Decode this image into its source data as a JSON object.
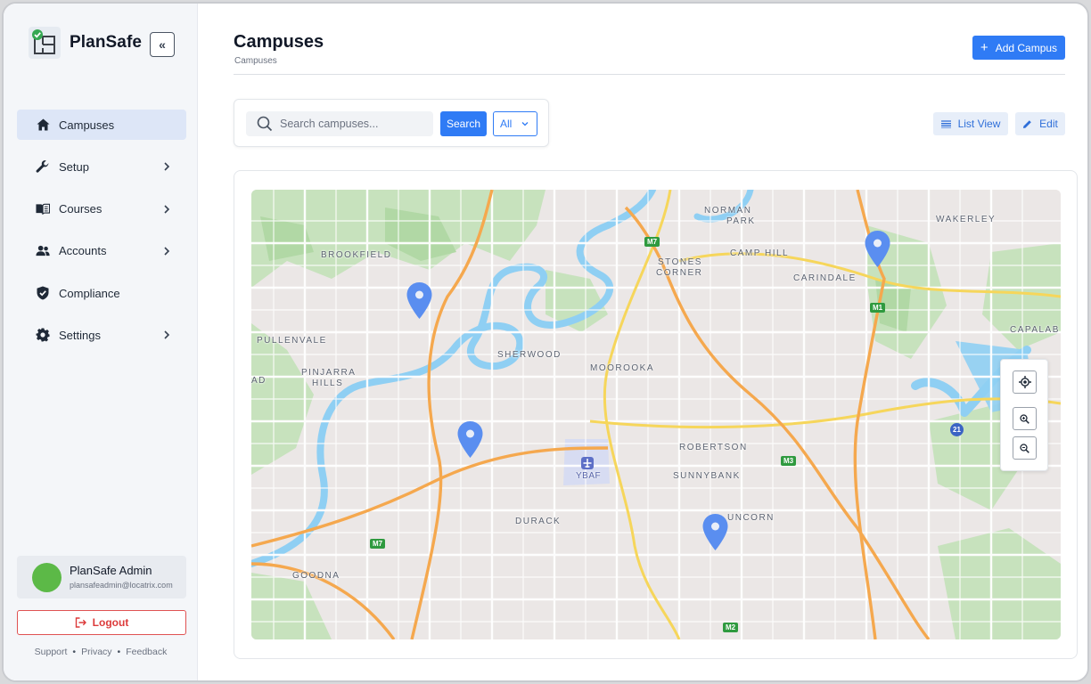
{
  "app": {
    "name": "PlanSafe",
    "collapse_label": "«",
    "logo_icon": "building-floorplan-check-icon"
  },
  "sidebar": {
    "items": [
      {
        "label": "Campuses",
        "icon": "home-icon",
        "active": true,
        "has_submenu": false
      },
      {
        "label": "Setup",
        "icon": "wrench-icon",
        "active": false,
        "has_submenu": true
      },
      {
        "label": "Courses",
        "icon": "book-icon",
        "active": false,
        "has_submenu": true
      },
      {
        "label": "Accounts",
        "icon": "users-icon",
        "active": false,
        "has_submenu": true
      },
      {
        "label": "Compliance",
        "icon": "shield-check-icon",
        "active": false,
        "has_submenu": false
      },
      {
        "label": "Settings",
        "icon": "gear-icon",
        "active": false,
        "has_submenu": true
      }
    ],
    "user": {
      "name": "PlanSafe Admin",
      "email": "plansafeadmin@locatrix.com"
    },
    "logout_label": "Logout",
    "footer_links": [
      "Support",
      "Privacy",
      "Feedback"
    ]
  },
  "header": {
    "title": "Campuses",
    "breadcrumb": "Campuses",
    "add_button": "Add Campus"
  },
  "toolbar": {
    "search_placeholder": "Search campuses...",
    "search_button": "Search",
    "filter_value": "All",
    "list_view_button": "List View",
    "edit_button": "Edit"
  },
  "map": {
    "suburbs": [
      "NORMAN",
      "PARK",
      "WAKERLEY",
      "BROOKFIELD",
      "CAMP HILL",
      "STONES",
      "CORNER",
      "CARINDALE",
      "PULLENVALE",
      "CAPALAB",
      "SHERWOOD",
      "MOOROOKA",
      "PINJARRA",
      "HILLS",
      "AD",
      "ROBERTSON",
      "SUNNYBANK",
      "YBAF",
      "DURACK",
      "UNCORN",
      "GOODNA"
    ],
    "road_shields": [
      "M7",
      "M1",
      "M3",
      "M7",
      "M2"
    ],
    "route_marker": "21",
    "campus_pins": 4,
    "colors": {
      "water": "#8fcff3",
      "park": "#c4e3b9",
      "motorway": "#f5a84e",
      "arterial": "#f6d65b",
      "pin": "#5a8ef0"
    }
  }
}
